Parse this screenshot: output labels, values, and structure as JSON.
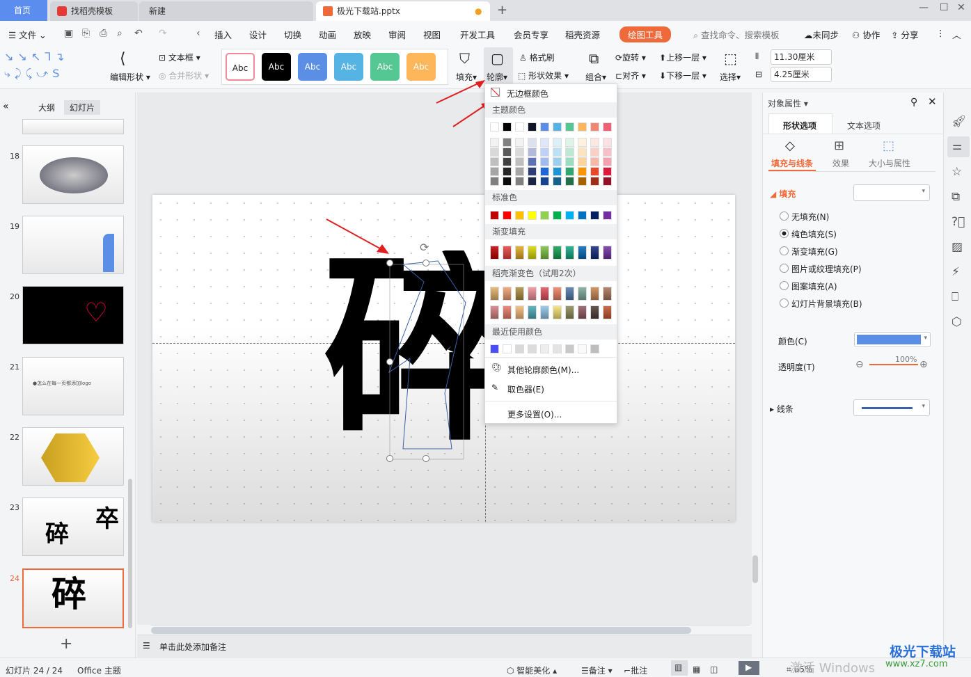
{
  "tabs": [
    {
      "label": "首页"
    },
    {
      "label": "找稻壳模板"
    },
    {
      "label": "新建"
    },
    {
      "label": "极光下载站.pptx"
    }
  ],
  "menu": {
    "file": "文件",
    "items": [
      "插入",
      "设计",
      "切换",
      "动画",
      "放映",
      "审阅",
      "视图",
      "开发工具",
      "会员专享",
      "稻壳资源"
    ],
    "drawing_tools": "绘图工具",
    "search_placeholder": "查找命令、搜索模板",
    "sync": "未同步",
    "collab": "协作",
    "share": "分享"
  },
  "ribbon": {
    "textbox": "文本框",
    "edit_shape": "编辑形状",
    "merge_shape": "合并形状",
    "styles": [
      "Abc",
      "Abc",
      "Abc",
      "Abc",
      "Abc",
      "Abc"
    ],
    "style_colors": [
      "#ffffff",
      "#000000",
      "#5b8fe6",
      "#56b4e5",
      "#55c793",
      "#fdb65a"
    ],
    "fill": "填充",
    "outline": "轮廓",
    "format_painter": "格式刷",
    "shape_effect": "形状效果",
    "group": "组合",
    "rotate": "旋转",
    "align": "对齐",
    "bring_forward": "上移一层",
    "send_backward": "下移一层",
    "select": "选择",
    "height": "11.30厘米",
    "width": "4.25厘米"
  },
  "left_panel": {
    "outline_tab": "大纲",
    "slides_tab": "幻灯片",
    "slides": [
      {
        "num": "18"
      },
      {
        "num": "19"
      },
      {
        "num": "20"
      },
      {
        "num": "21",
        "text": "●怎么在每一页都添加logo"
      },
      {
        "num": "22"
      },
      {
        "num": "23",
        "text": "碎",
        "text2": "卒"
      },
      {
        "num": "24",
        "text": "碎"
      }
    ]
  },
  "slide": {
    "big_text": "碎"
  },
  "notes": {
    "placeholder": "单击此处添加备注"
  },
  "outline_menu": {
    "no_border": "无边框颜色",
    "theme_colors": "主题颜色",
    "standard": "标准色",
    "gradient": "渐变填充",
    "daoke": "稻壳渐变色（试用2次）",
    "recent": "最近使用颜色",
    "more_colors": "其他轮廓颜色(M)...",
    "eyedropper": "取色器(E)",
    "more_settings": "更多设置(O)...",
    "theme_top": [
      "#ffffff",
      "#000000",
      "#ffffff",
      "#0f1628",
      "#5b8fe6",
      "#56b4e5",
      "#55c793",
      "#fdb65a",
      "#f18873",
      "#ef6177"
    ],
    "theme_shades": [
      [
        "#f2f2f2",
        "#808080",
        "#f2f2f2",
        "#dde0ee",
        "#dfe8fa",
        "#ddeff9",
        "#ddf4e9",
        "#fff1dd",
        "#fde7e2",
        "#fde0e4"
      ],
      [
        "#d9d9d9",
        "#595959",
        "#d9d9d9",
        "#b3b9dc",
        "#bfd2f5",
        "#bbe1f4",
        "#bbe9d4",
        "#ffe3bd",
        "#fad0c6",
        "#f9c0ca"
      ],
      [
        "#bfbfbf",
        "#404040",
        "#bfbfbf",
        "#5f71b6",
        "#9ebcef",
        "#99d1ee",
        "#99dfbf",
        "#ffd49b",
        "#f7b8a9",
        "#f5a1af"
      ],
      [
        "#a6a6a6",
        "#262626",
        "#a6a6a6",
        "#2e3d73",
        "#1f67d5",
        "#1f95d3",
        "#31a66f",
        "#ff9300",
        "#e8482a",
        "#de1a3c"
      ],
      [
        "#808080",
        "#0d0d0d",
        "#808080",
        "#1b2545",
        "#16458f",
        "#15628c",
        "#21704b",
        "#a86300",
        "#a02d18",
        "#931129"
      ]
    ],
    "standard_colors": [
      "#c00000",
      "#ff0000",
      "#ffc000",
      "#ffff00",
      "#92d050",
      "#00b050",
      "#00b0f0",
      "#0070c0",
      "#002060",
      "#7030a0"
    ],
    "gradient_colors": [
      "#c00000",
      "#e84040",
      "#e0a820",
      "#d8d800",
      "#78c040",
      "#10a050",
      "#10a880",
      "#0068b8",
      "#102878",
      "#7030a0"
    ],
    "daoke_colors": [
      [
        "#e2b067",
        "#ef9e6f",
        "#a98c3c",
        "#f18d96",
        "#e04e5a",
        "#ee8064",
        "#4f79a8",
        "#7ba99a",
        "#c98550",
        "#a77458"
      ],
      [
        "#d47e80",
        "#e87a66",
        "#f3b878",
        "#4aa8b6",
        "#8ec3e6",
        "#f4e070",
        "#8c8a58",
        "#8f5860",
        "#4b3c34",
        "#c2552f"
      ]
    ],
    "recent_colors": [
      "#4a4ef5",
      "#ffffff",
      "#d9d9d9",
      "#dcdcdc",
      "#eeeeee",
      "#e4e4e4",
      "#c9c9c9",
      "#fafafa",
      "#bdbdbd"
    ]
  },
  "right_panel": {
    "title": "对象属性",
    "tab_shape": "形状选项",
    "tab_text": "文本选项",
    "sub_fill_line": "填充与线条",
    "sub_effect": "效果",
    "sub_size": "大小与属性",
    "fill_section": "填充",
    "fill_options": [
      "无填充(N)",
      "纯色填充(S)",
      "渐变填充(G)",
      "图片或纹理填充(P)",
      "图案填充(A)",
      "幻灯片背景填充(B)"
    ],
    "selected_fill": 1,
    "color_label": "颜色(C)",
    "color_value": "#5b8fe6",
    "transparency_label": "透明度(T)",
    "transparency_value": "100%",
    "line_section": "线条",
    "accent": "#ef6a3a"
  },
  "status": {
    "slide_count": "幻灯片 24 / 24",
    "theme": "Office 主题",
    "beautify": "智能美化",
    "notes": "备注",
    "comment": "批注",
    "zoom": "65%",
    "watermark": "激活 Windows",
    "logo": "极光下载站",
    "logo_url": "www.xz7.com"
  }
}
